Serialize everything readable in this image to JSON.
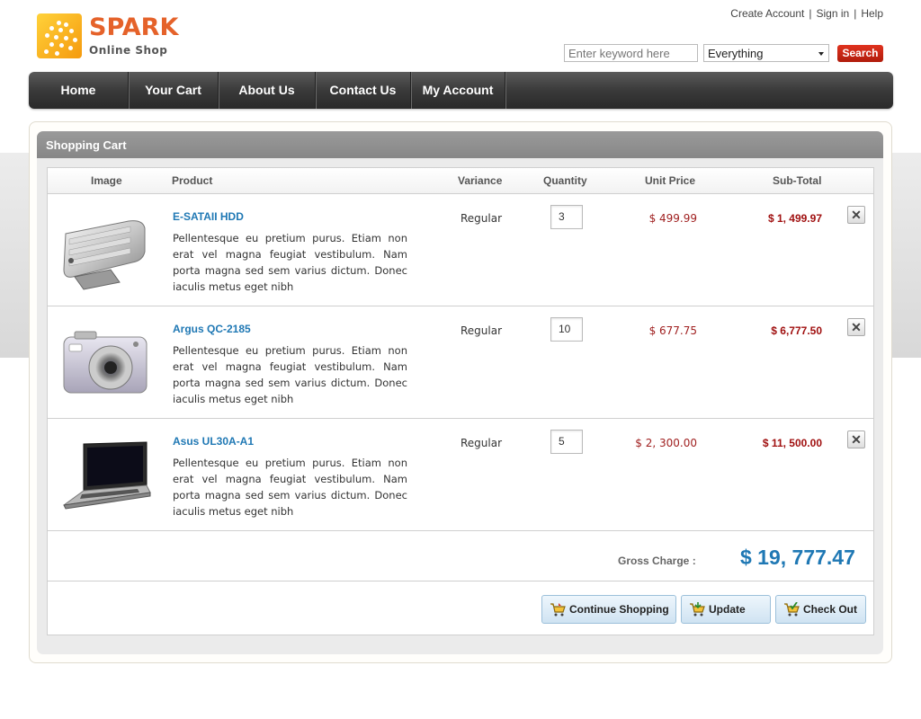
{
  "header": {
    "logo_title": "SPARK",
    "logo_subtitle": "Online Shop",
    "links": [
      "Create Account",
      "Sign in",
      "Help"
    ],
    "search_placeholder": "Enter keyword here",
    "search_scope": "Everything",
    "search_button": "Search"
  },
  "nav": {
    "items": [
      "Home",
      "Your Cart",
      "About Us",
      "Contact Us",
      "My Account"
    ]
  },
  "cart": {
    "title": "Shopping Cart",
    "columns": [
      "Image",
      "Product",
      "Variance",
      "Quantity",
      "Unit Price",
      "Sub-Total"
    ],
    "items": [
      {
        "name": "E-SATAII HDD",
        "description": "Pellentesque eu pretium purus. Etiam non erat vel magna feugiat vestibulum. Nam porta magna sed sem varius dictum. Donec iaculis metus eget nibh",
        "variance": "Regular",
        "quantity": "3",
        "unit_price": "$ 499.99",
        "subtotal": "$ 1, 499.97",
        "image_icon": "hard-drive-image"
      },
      {
        "name": "Argus QC-2185",
        "description": "Pellentesque eu pretium purus. Etiam non erat vel magna feugiat vestibulum. Nam porta magna sed sem varius dictum. Donec iaculis metus eget nibh",
        "variance": "Regular",
        "quantity": "10",
        "unit_price": "$ 677.75",
        "subtotal": "$ 6,777.50",
        "image_icon": "camera-image"
      },
      {
        "name": "Asus UL30A-A1",
        "description": "Pellentesque eu pretium purus. Etiam non erat vel magna feugiat vestibulum. Nam porta magna sed sem varius dictum. Donec iaculis metus eget nibh",
        "variance": "Regular",
        "quantity": "5",
        "unit_price": "$ 2, 300.00",
        "subtotal": "$ 11, 500.00",
        "image_icon": "laptop-image"
      }
    ],
    "gross_label": "Gross Charge :",
    "gross_value": "$ 19, 777.47",
    "buttons": {
      "continue": "Continue Shopping",
      "update": "Update",
      "checkout": "Check Out"
    },
    "remove_symbol": "✕"
  },
  "colors": {
    "accent_blue": "#1f78b4",
    "price_red": "#a01010",
    "brand_orange": "#e5622a",
    "search_red": "#c8260f"
  }
}
